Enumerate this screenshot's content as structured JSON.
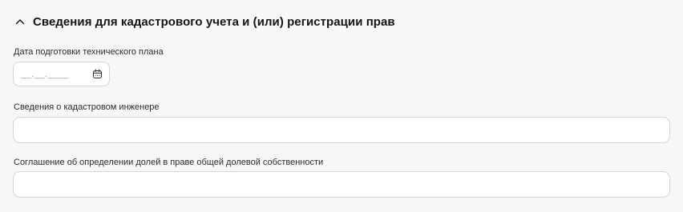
{
  "section": {
    "title": "Сведения для кадастрового учета и (или) регистрации прав",
    "expanded": true,
    "toggle_icon": "chevron-up-icon"
  },
  "fields": {
    "prep_date": {
      "label": "Дата подготовки технического плана",
      "value": "",
      "mask": "__.__.____",
      "icon": "calendar-icon"
    },
    "engineer": {
      "label": "Сведения о кадастровом инженере",
      "value": ""
    },
    "agreement": {
      "label": "Соглашение об определении долей в праве общей долевой собственности",
      "value": ""
    }
  },
  "colors": {
    "background": "#f7f7f7",
    "input_border": "#d6d6d6",
    "input_background": "#ffffff",
    "text": "#1a1a1a",
    "mask_text": "#9a9a9a"
  }
}
